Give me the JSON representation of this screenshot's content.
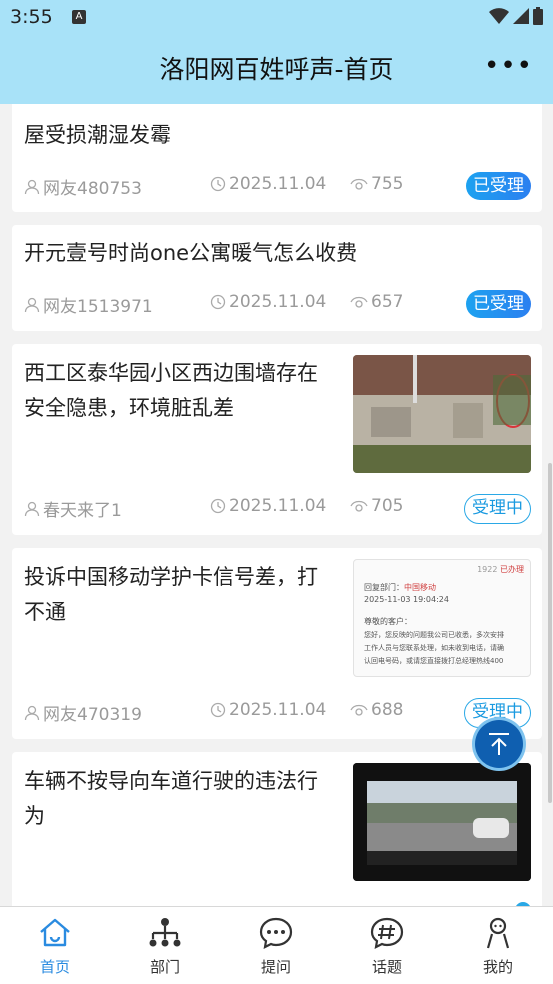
{
  "status": {
    "time": "3:55",
    "notif_letter": "A"
  },
  "header": {
    "title": "洛阳网百姓呼声-首页",
    "more": "•••"
  },
  "posts": [
    {
      "title_line1": "",
      "title_line2": "屋受损潮湿发霉",
      "user": "网友480753",
      "date": "2025.11.04",
      "views": "755",
      "status": "已受理"
    },
    {
      "title_line1": "开元壹号时尚one公寓暖气怎么收费",
      "user": "网友1513971",
      "date": "2025.11.04",
      "views": "657",
      "status": "已受理"
    },
    {
      "title_line1": "西工区泰华园小区西边围墙存在",
      "title_line2": "安全隐患，环境脏乱差",
      "user": "春天来了1",
      "date": "2025.11.04",
      "views": "705",
      "status": "受理中"
    },
    {
      "title_line1": "投诉中国移动学护卡信号差，打",
      "title_line2": "不通",
      "user": "网友470319",
      "date": "2025.11.04",
      "views": "688",
      "status": "受理中",
      "thumb": {
        "views": "1922",
        "done": "已办理",
        "dept_label": "回复部门：",
        "dept": "中国移动",
        "time": "2025-11-03 19:04:24",
        "greeting": "尊敬的客户：",
        "body1": "您好，您反映的问题我公司已收悉，多次安排",
        "body2": "工作人员与您联系处理，如未收到电话，请确",
        "body3": "认回电号码，或请您直接拨打总经理热线400"
      }
    },
    {
      "title_line1": "车辆不按导向车道行驶的违法行",
      "title_line2": "为"
    }
  ],
  "tabs": [
    {
      "label": "首页",
      "icon": "home-icon",
      "active": true
    },
    {
      "label": "部门",
      "icon": "org-chart-icon"
    },
    {
      "label": "提问",
      "icon": "chat-bubble-icon"
    },
    {
      "label": "话题",
      "icon": "topic-hash-icon"
    },
    {
      "label": "我的",
      "icon": "user-icon"
    }
  ],
  "colors": {
    "header_bg": "#a8e2f8",
    "accent": "#2a8be0",
    "badge_done": "#1da2f0",
    "badge_doing": "#2aa8e6",
    "back_to_top": "#0f5fb0"
  }
}
